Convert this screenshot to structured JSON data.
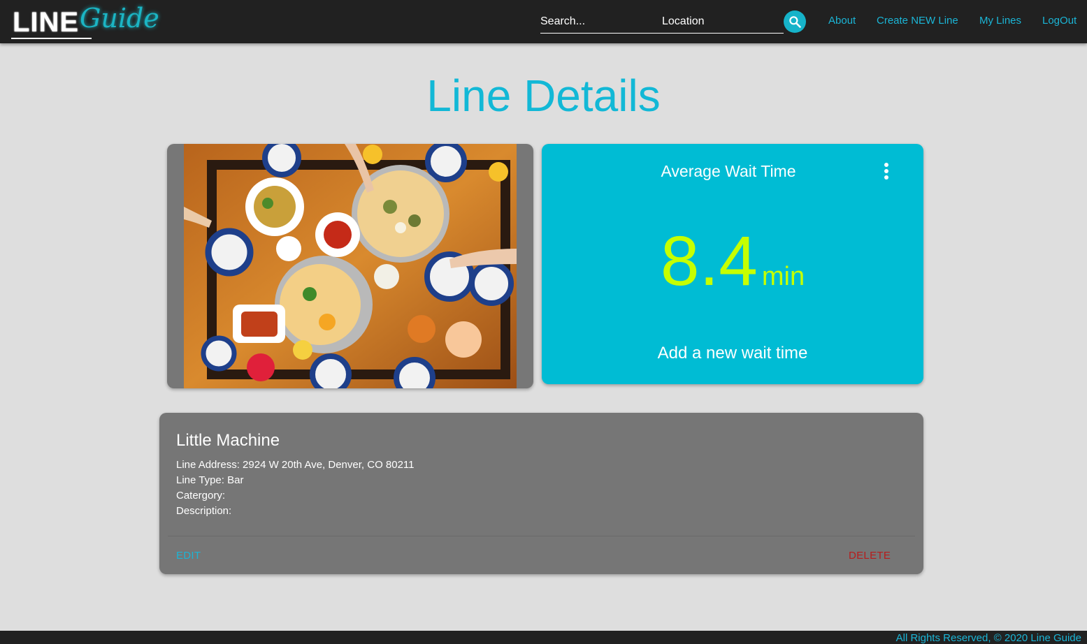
{
  "app": {
    "logo": {
      "line_text": "LINE",
      "guide_text": "Guide"
    }
  },
  "header": {
    "search": {
      "placeholder": "Search...",
      "value": ""
    },
    "location": {
      "placeholder": "Location",
      "value": ""
    },
    "search_button_icon": "search-icon",
    "nav": {
      "about": "About",
      "create_line": "Create NEW Line",
      "my_lines": "My Lines",
      "logout": "LogOut"
    }
  },
  "main": {
    "title": "Line Details",
    "image": {
      "subject": "food-photo"
    },
    "wait_card": {
      "title": "Average Wait Time",
      "value": "8.4",
      "unit": "min",
      "add_label": "Add a new wait time",
      "menu_icon": "more-vertical-icon"
    },
    "details": {
      "name": "Little Machine",
      "address": "Line Address: 2924 W 20th Ave, Denver, CO 80211",
      "type": "Line Type: Bar",
      "category": "Catergory:",
      "description": "Description:",
      "edit_label": "EDIT",
      "delete_label": "DELETE"
    }
  },
  "footer": {
    "text": "All Rights Reserved, © 2020 Line Guide"
  },
  "colors": {
    "accent": "#00bcd4",
    "nav_link": "#1bb5d6",
    "wait_value": "#c6ff00",
    "delete": "#b71c1c",
    "navbar_bg": "#212121",
    "page_bg": "#dedede"
  }
}
